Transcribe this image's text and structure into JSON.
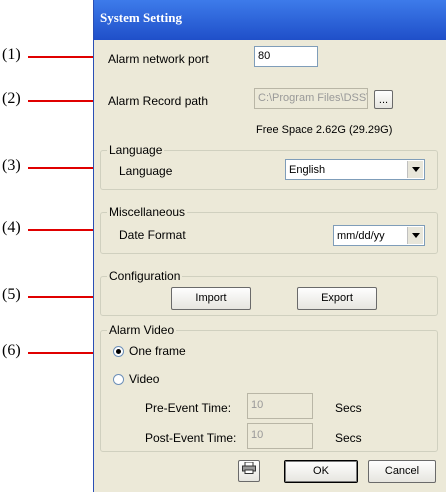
{
  "callouts": [
    "(1)",
    "(2)",
    "(3)",
    "(4)",
    "(5)",
    "(6)"
  ],
  "window": {
    "title": "System Setting"
  },
  "network": {
    "label": "Alarm network port",
    "value": "80"
  },
  "record": {
    "label": "Alarm Record path",
    "value": "C:\\Program Files\\DSS\\CM",
    "browse_label": "...",
    "free_space": "Free Space 2.62G (29.29G)"
  },
  "language": {
    "group": "Language",
    "label": "Language",
    "selected": "English"
  },
  "misc": {
    "group": "Miscellaneous",
    "label": "Date Format",
    "selected": "mm/dd/yy"
  },
  "config": {
    "group": "Configuration",
    "import_label": "Import",
    "export_label": "Export"
  },
  "alarm_video": {
    "group": "Alarm Video",
    "option_one_frame": "One frame",
    "option_video": "Video",
    "selected": "One frame",
    "pre_label": "Pre-Event Time:",
    "pre_value": "10",
    "post_label": "Post-Event Time:",
    "post_value": "10",
    "unit": "Secs"
  },
  "footer": {
    "ok_label": "OK",
    "cancel_label": "Cancel",
    "print_icon": "printer-icon"
  },
  "colors": {
    "callout_line": "#e00000",
    "title_bar": "#1f4fc9",
    "dialog_bg": "#ece9d8"
  }
}
